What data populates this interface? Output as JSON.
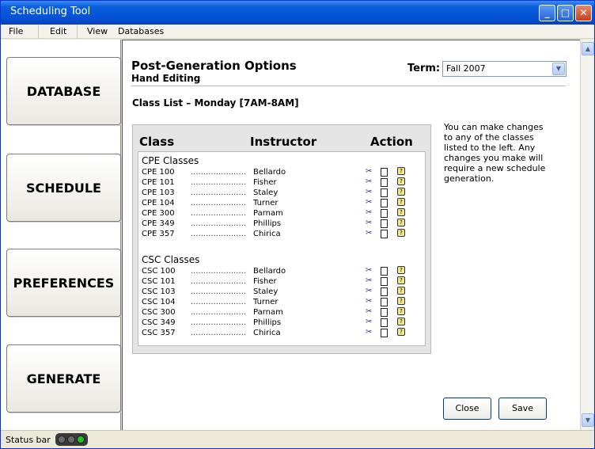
{
  "window": {
    "title": "Scheduling Tool"
  },
  "menubar": {
    "items": [
      "File",
      "Edit",
      "View",
      "Databases"
    ]
  },
  "sidebar": {
    "buttons": [
      "DATABASE",
      "SCHEDULE",
      "PREFERENCES",
      "GENERATE"
    ]
  },
  "header": {
    "title": "Post-Generation Options",
    "subtitle": "Hand Editing",
    "term_label": "Term:",
    "term_value": "Fall 2007"
  },
  "classlist": {
    "title": "Class List – Monday [7AM-8AM]"
  },
  "table": {
    "headers": [
      "Class",
      "Instructor",
      "Action"
    ],
    "dots": "......................",
    "groups": [
      {
        "title": "CPE Classes",
        "rows": [
          {
            "code": "CPE 100",
            "instructor": "Bellardo"
          },
          {
            "code": "CPE 101",
            "instructor": "Fisher"
          },
          {
            "code": "CPE 103",
            "instructor": "Staley"
          },
          {
            "code": "CPE 104",
            "instructor": "Turner"
          },
          {
            "code": "CPE 300",
            "instructor": "Parnam"
          },
          {
            "code": "CPE 349",
            "instructor": "Phillips"
          },
          {
            "code": "CPE 357",
            "instructor": "Chirica"
          }
        ]
      },
      {
        "title": "CSC Classes",
        "rows": [
          {
            "code": "CSC 100",
            "instructor": "Bellardo"
          },
          {
            "code": "CSC 101",
            "instructor": "Fisher"
          },
          {
            "code": "CSC 103",
            "instructor": "Staley"
          },
          {
            "code": "CSC 104",
            "instructor": "Turner"
          },
          {
            "code": "CSC 300",
            "instructor": "Parnam"
          },
          {
            "code": "CSC 349",
            "instructor": "Phillips"
          },
          {
            "code": "CSC 357",
            "instructor": "Chirica"
          }
        ]
      }
    ],
    "action_icons": [
      "scissors-icon",
      "document-icon",
      "help-bubble-icon"
    ]
  },
  "note": "You can make changes to any of the classes listed to the left.  Any changes you make will require a new schedule generation.",
  "buttons": {
    "close": "Close",
    "save": "Save"
  },
  "statusbar": {
    "text": "Status bar",
    "lights": [
      "off",
      "off",
      "green"
    ]
  },
  "colors": {
    "titlebar": "#0453d6",
    "status_green": "#24c224",
    "help_icon": "#f4e98a"
  }
}
